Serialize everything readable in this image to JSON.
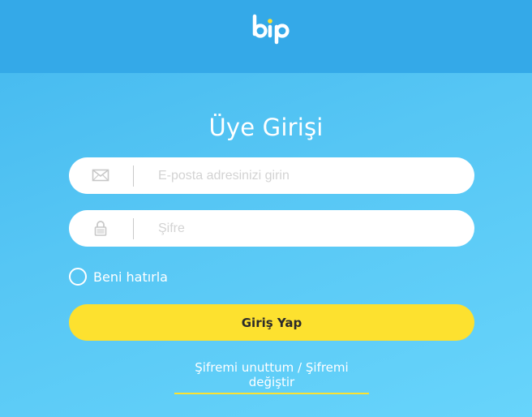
{
  "header": {
    "logo_text": "bip"
  },
  "login": {
    "title": "Üye Girişi",
    "email_placeholder": "E-posta adresinizi girin",
    "password_placeholder": "Şifre",
    "remember_label": "Beni hatırla",
    "submit_label": "Giriş Yap",
    "forgot_label": "Şifremi unuttum",
    "separator": " / ",
    "change_label": "Şifremi değiştir"
  },
  "icons": {
    "email": "envelope-icon",
    "password": "lock-icon",
    "logo": "bip-logo"
  },
  "colors": {
    "header_bg": "#34a9e8",
    "page_bg": "#56c6f4",
    "accent_yellow": "#fde12f",
    "logo_dot": "#fde12f"
  }
}
